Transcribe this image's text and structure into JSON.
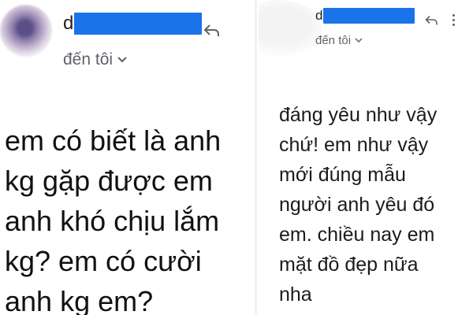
{
  "left": {
    "sender_visible": "d",
    "to_label": "đến tôi",
    "message_lines": [
      "em có biết là anh",
      "kg gặp được em",
      "anh khó chịu lắm",
      "kg? em có cười",
      "anh kg em?"
    ]
  },
  "right": {
    "sender_visible": "d",
    "to_label": "đến tôi",
    "message_lines": [
      "đáng yêu như vậy",
      "chứ! em như vậy",
      "mới đúng mẫu",
      "người anh yêu đó",
      "em.  chiều nay em",
      "mặt đồ đẹp nữa",
      "nha"
    ]
  },
  "icons": {
    "reply": "reply-icon",
    "more": "more-vert-icon",
    "expand": "chevron-down-icon"
  },
  "colors": {
    "redaction": "#1a73e8",
    "secondary_text": "#5f6368",
    "body_text": "#111111"
  }
}
